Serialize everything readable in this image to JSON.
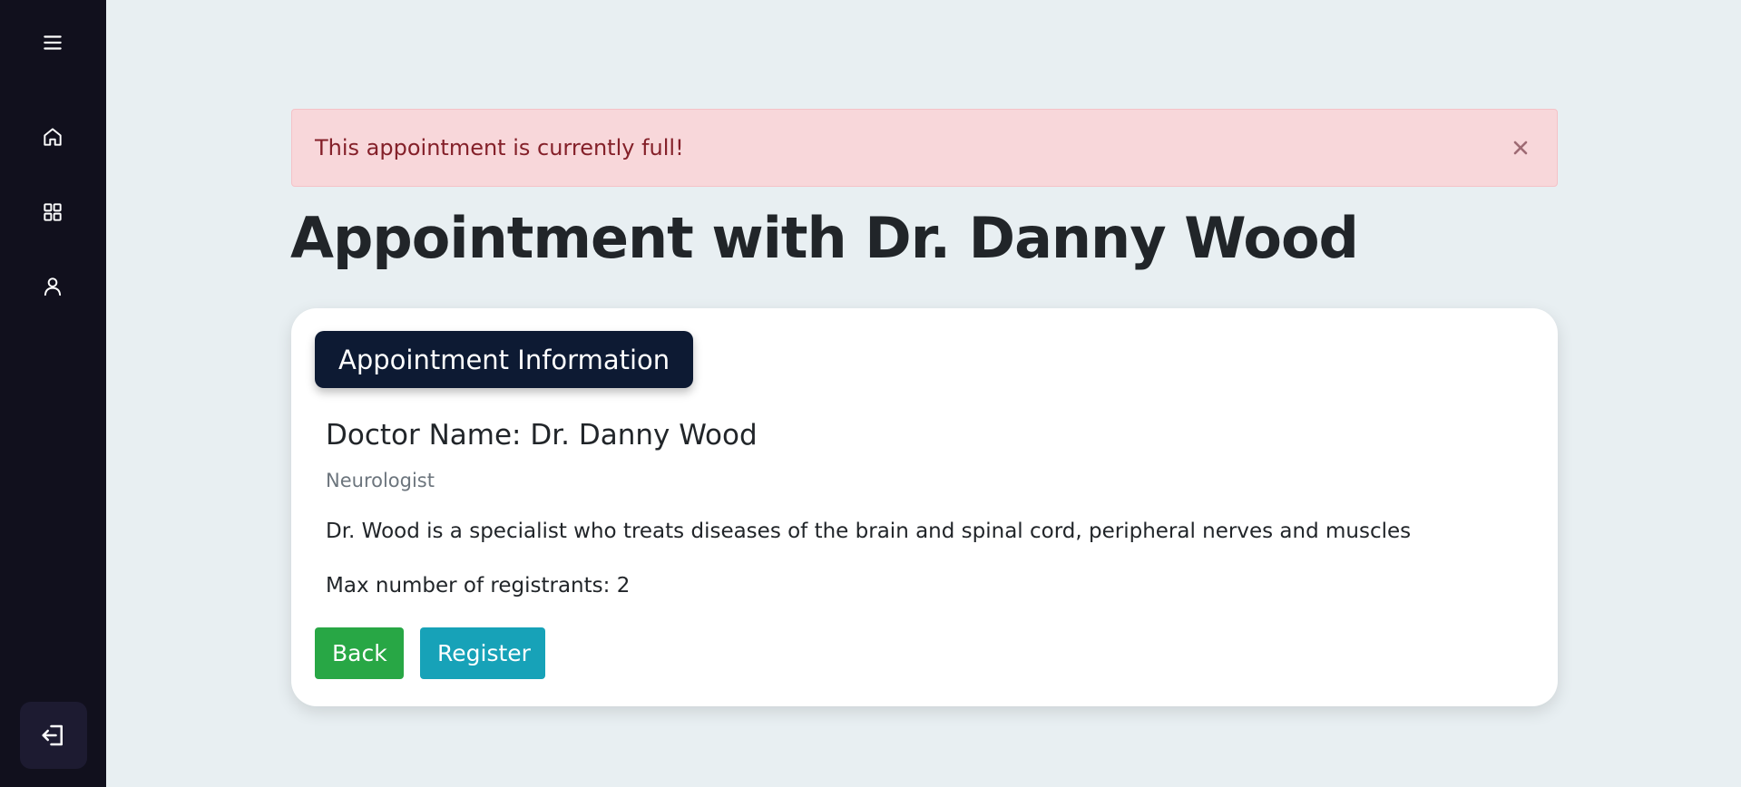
{
  "sidebar": {
    "menu_icon": "hamburger-menu-icon",
    "items": [
      {
        "icon": "home-icon"
      },
      {
        "icon": "grid-icon"
      },
      {
        "icon": "user-icon"
      }
    ],
    "logout_icon": "log-out-icon"
  },
  "alert": {
    "message": "This appointment is currently full!",
    "close_icon": "close-icon"
  },
  "page": {
    "title": "Appointment with Dr. Danny Wood"
  },
  "card": {
    "badge": "Appointment Information",
    "doctor_label": "Doctor Name:",
    "doctor_name": "Dr. Danny Wood",
    "specialty": "Neurologist",
    "description": "Dr. Wood is a specialist who treats diseases of the brain and spinal cord, peripheral nerves and muscles",
    "max_label": "Max number of registrants:",
    "max_value": "2"
  },
  "buttons": {
    "back": "Back",
    "register": "Register"
  },
  "colors": {
    "sidebar_bg": "#11101d",
    "page_bg": "#e8eff2",
    "alert_bg": "#f8d7da",
    "alert_text": "#842029",
    "badge_bg": "#0d1a33",
    "back_button": "#28a745",
    "register_button": "#17a2b8"
  }
}
